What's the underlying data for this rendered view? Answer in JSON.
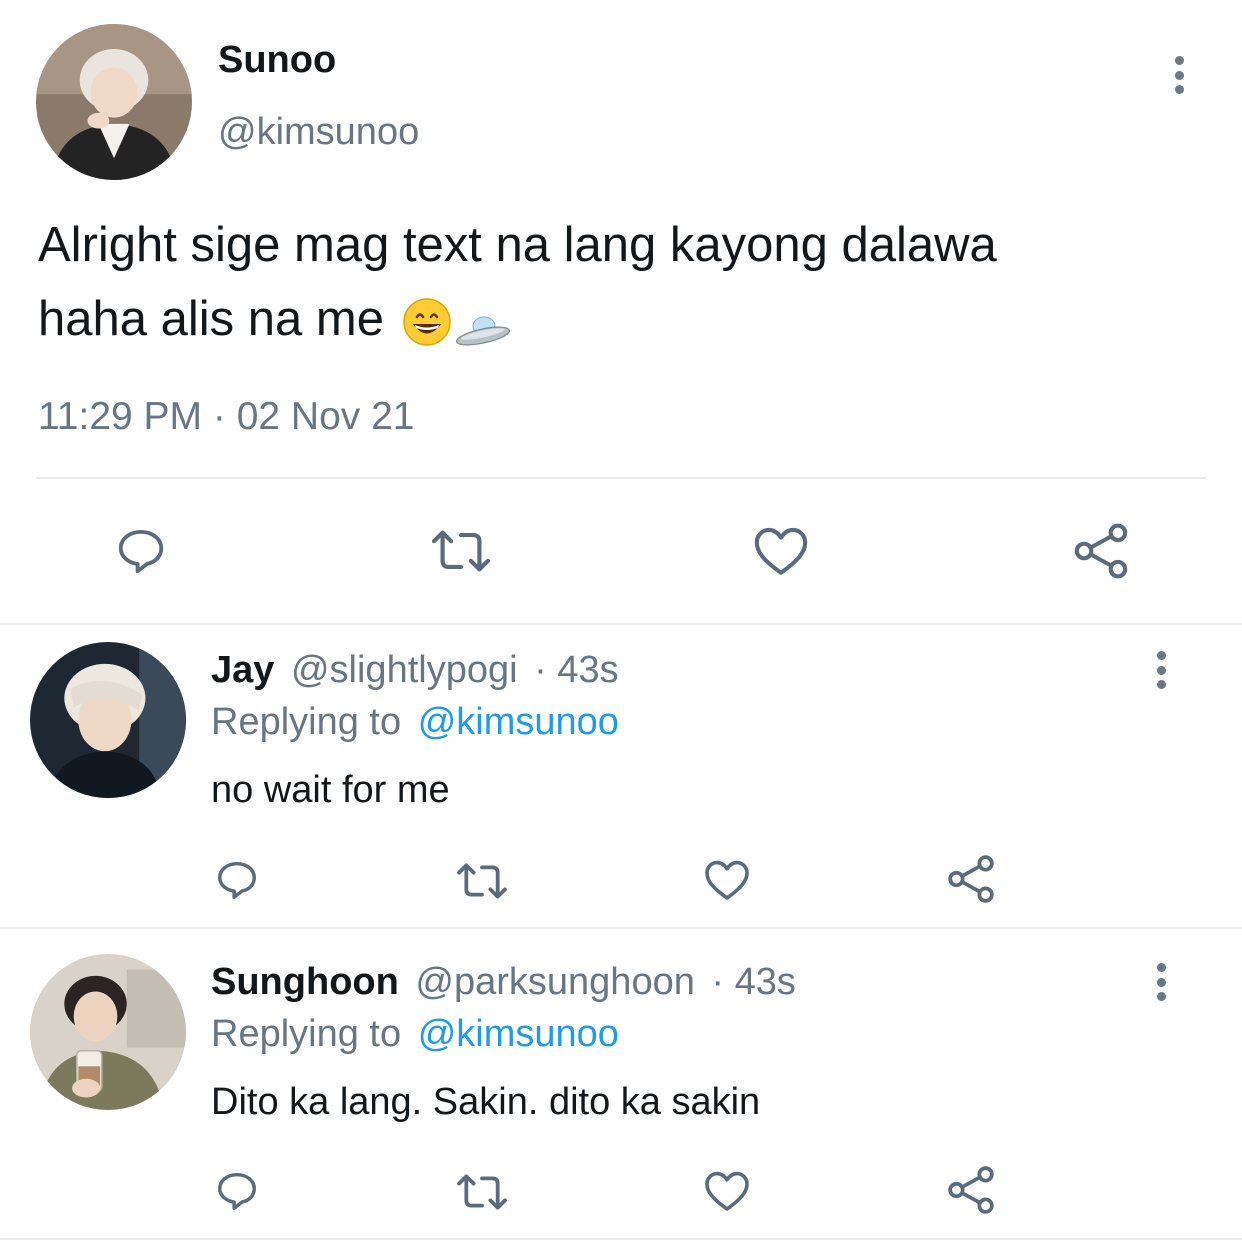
{
  "main_tweet": {
    "author_name": "Sunoo",
    "author_handle": "@kimsunoo",
    "text_line1": "Alright sige mag text na lang kayong dalawa",
    "text_line2": "haha alis na me",
    "emojis": [
      "grinning-face-emoji",
      "flying-saucer-emoji"
    ],
    "timestamp": "11:29 PM · 02 Nov 21",
    "actions": [
      "reply-icon",
      "retweet-icon",
      "like-icon",
      "share-icon"
    ]
  },
  "replies": [
    {
      "author_name": "Jay",
      "author_handle": "@slightlypogi",
      "time": "· 43s",
      "replying_prefix": "Replying to",
      "replying_to": "@kimsunoo",
      "text": "no wait for me"
    },
    {
      "author_name": "Sunghoon",
      "author_handle": "@parksunghoon",
      "time": "· 43s",
      "replying_prefix": "Replying to",
      "replying_to": "@kimsunoo",
      "text": "Dito ka lang. Sakin. dito ka sakin"
    }
  ],
  "colors": {
    "text": "#14171a",
    "muted": "#687684",
    "link": "#1d9bf0",
    "icon": "#5b6b7b",
    "divider": "#e8ecef"
  }
}
